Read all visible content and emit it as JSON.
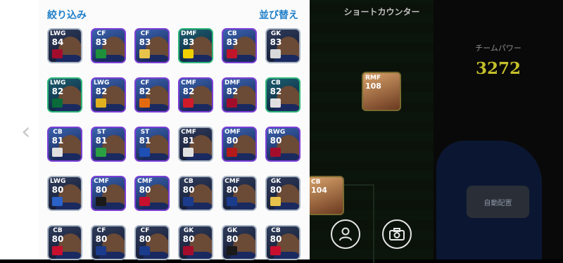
{
  "header": {
    "filter_label": "絞り込み",
    "sort_label": "並び替え"
  },
  "right": {
    "shortcut_label": "ショートカウンター",
    "team_power_label": "チームパワー",
    "team_power_value": "3272",
    "auto_assign_label": "自動配置"
  },
  "pitch_cards": [
    {
      "pos": "RMF",
      "ovr": "108"
    },
    {
      "pos": "CB",
      "ovr": "104"
    }
  ],
  "players": [
    {
      "pos": "LWG",
      "ovr": "84",
      "style": "silver",
      "badge": "#a30d2c"
    },
    {
      "pos": "CF",
      "ovr": "83",
      "style": "purple",
      "badge": "#1e8f3b"
    },
    {
      "pos": "CF",
      "ovr": "83",
      "style": "purple",
      "badge": "#e8c34b"
    },
    {
      "pos": "DMF",
      "ovr": "83",
      "style": "green",
      "badge": "#f0d000"
    },
    {
      "pos": "CB",
      "ovr": "83",
      "style": "purple",
      "badge": "#c0152b"
    },
    {
      "pos": "GK",
      "ovr": "83",
      "style": "silver",
      "badge": "#d9d9d9"
    },
    {
      "pos": "LWG",
      "ovr": "82",
      "style": "green",
      "badge": "#0a6a3a"
    },
    {
      "pos": "LWG",
      "ovr": "82",
      "style": "purple",
      "badge": "#e0b020"
    },
    {
      "pos": "CF",
      "ovr": "82",
      "style": "purple",
      "badge": "#e46a10"
    },
    {
      "pos": "CMF",
      "ovr": "82",
      "style": "purple",
      "badge": "#d11b2a"
    },
    {
      "pos": "DMF",
      "ovr": "82",
      "style": "purple",
      "badge": "#a30d2c"
    },
    {
      "pos": "CB",
      "ovr": "82",
      "style": "green",
      "badge": "#e0e0e0"
    },
    {
      "pos": "CB",
      "ovr": "81",
      "style": "purple",
      "badge": "#e0e0e0"
    },
    {
      "pos": "ST",
      "ovr": "81",
      "style": "purple",
      "badge": "#2aa042"
    },
    {
      "pos": "ST",
      "ovr": "81",
      "style": "purple",
      "badge": "#1e4fb5"
    },
    {
      "pos": "CMF",
      "ovr": "81",
      "style": "silver",
      "badge": "#e0e0e0"
    },
    {
      "pos": "OMF",
      "ovr": "80",
      "style": "purple",
      "badge": "#b31b1b"
    },
    {
      "pos": "RWG",
      "ovr": "80",
      "style": "purple",
      "badge": "#a30d2c"
    },
    {
      "pos": "LWG",
      "ovr": "80",
      "style": "silver",
      "badge": "#2b62c9"
    },
    {
      "pos": "CMF",
      "ovr": "80",
      "style": "purple",
      "badge": "#1a1a1a"
    },
    {
      "pos": "CMF",
      "ovr": "80",
      "style": "purple",
      "badge": "#c8102e"
    },
    {
      "pos": "CB",
      "ovr": "80",
      "style": "silver",
      "badge": "#1b3b8c"
    },
    {
      "pos": "CMF",
      "ovr": "80",
      "style": "silver",
      "badge": "#1b3b8c"
    },
    {
      "pos": "GK",
      "ovr": "80",
      "style": "silver",
      "badge": "#e8c34b"
    },
    {
      "pos": "CB",
      "ovr": "80",
      "style": "silver",
      "badge": "#c8102e"
    },
    {
      "pos": "CF",
      "ovr": "80",
      "style": "silver",
      "badge": "#1b3b8c"
    },
    {
      "pos": "CF",
      "ovr": "80",
      "style": "silver",
      "badge": "#1b3b8c"
    },
    {
      "pos": "GK",
      "ovr": "80",
      "style": "silver",
      "badge": "#a30d2c"
    },
    {
      "pos": "GK",
      "ovr": "80",
      "style": "silver",
      "badge": "#1a1a1a"
    },
    {
      "pos": "CB",
      "ovr": "80",
      "style": "silver",
      "badge": "#c8102e"
    }
  ]
}
